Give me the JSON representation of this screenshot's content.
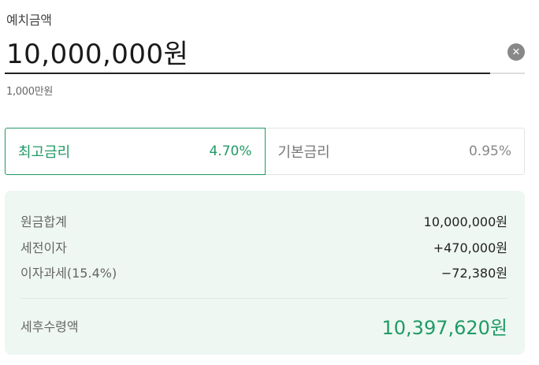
{
  "deposit": {
    "label": "예치금액",
    "amount": "10,000,000원",
    "hint": "1,000만원",
    "clear_glyph": "✕"
  },
  "rate_tabs": [
    {
      "name": "최고금리",
      "rate": "4.70%",
      "selected": true
    },
    {
      "name": "기본금리",
      "rate": "0.95%",
      "selected": false
    }
  ],
  "summary": {
    "principal_label": "원금합계",
    "principal_value": "10,000,000원",
    "interest_label": "세전이자",
    "interest_value": "+470,000원",
    "tax_label": "이자과세(15.4%)",
    "tax_value": "−72,380원",
    "net_label": "세후수령액",
    "net_value": "10,397,620원"
  },
  "colors": {
    "accent": "#1f9a66",
    "card_background": "#eef7f1"
  }
}
